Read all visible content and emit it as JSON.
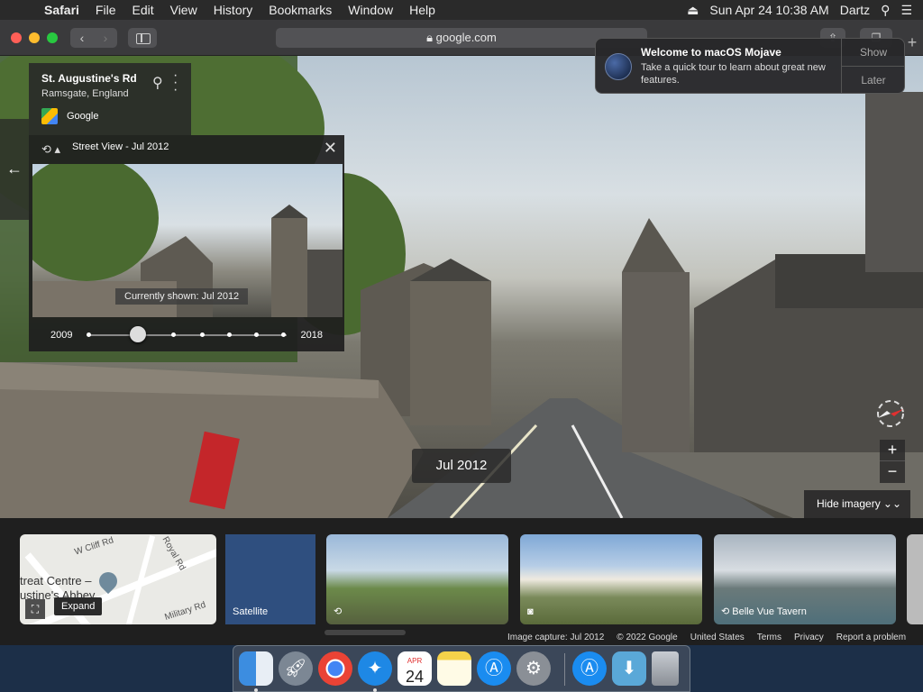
{
  "menubar": {
    "app": "Safari",
    "items": [
      "File",
      "Edit",
      "View",
      "History",
      "Bookmarks",
      "Window",
      "Help"
    ],
    "datetime": "Sun Apr 24  10:38 AM",
    "user": "Dartz"
  },
  "browser": {
    "url": "google.com"
  },
  "notification": {
    "title": "Welcome to macOS Mojave",
    "message": "Take a quick tour to learn about great new features.",
    "show_label": "Show",
    "later_label": "Later"
  },
  "place": {
    "name": "St. Augustine's Rd",
    "locality": "Ramsgate, England",
    "provider": "Google"
  },
  "timemachine": {
    "header": "Street View - Jul 2012",
    "currently_shown": "Currently shown: Jul 2012",
    "year_start": "2009",
    "year_end": "2018",
    "slider_position": 0.25
  },
  "viewer": {
    "date_label": "Jul 2012",
    "hide_imagery_label": "Hide imagery",
    "zoom_in": "+",
    "zoom_out": "−"
  },
  "strip": {
    "map": {
      "labels": [
        "W Cliff Rd",
        "Royal Rd",
        "treat Centre –",
        "ustine's Abbey",
        "Military Rd"
      ],
      "expand_label": "Expand"
    },
    "satellite_label": "Satellite",
    "tavern_label": "Belle Vue Tavern"
  },
  "footer": {
    "capture": "Image capture: Jul 2012",
    "copyright": "© 2022 Google",
    "country": "United States",
    "terms": "Terms",
    "privacy": "Privacy",
    "report": "Report a problem"
  },
  "dock": {
    "calendar_month": "APR",
    "calendar_day": "24"
  },
  "colors": {
    "menubar_bg": "#2a2a2a",
    "chrome_bg": "#3a3a3c",
    "panel_bg": "#1e1e1e"
  }
}
